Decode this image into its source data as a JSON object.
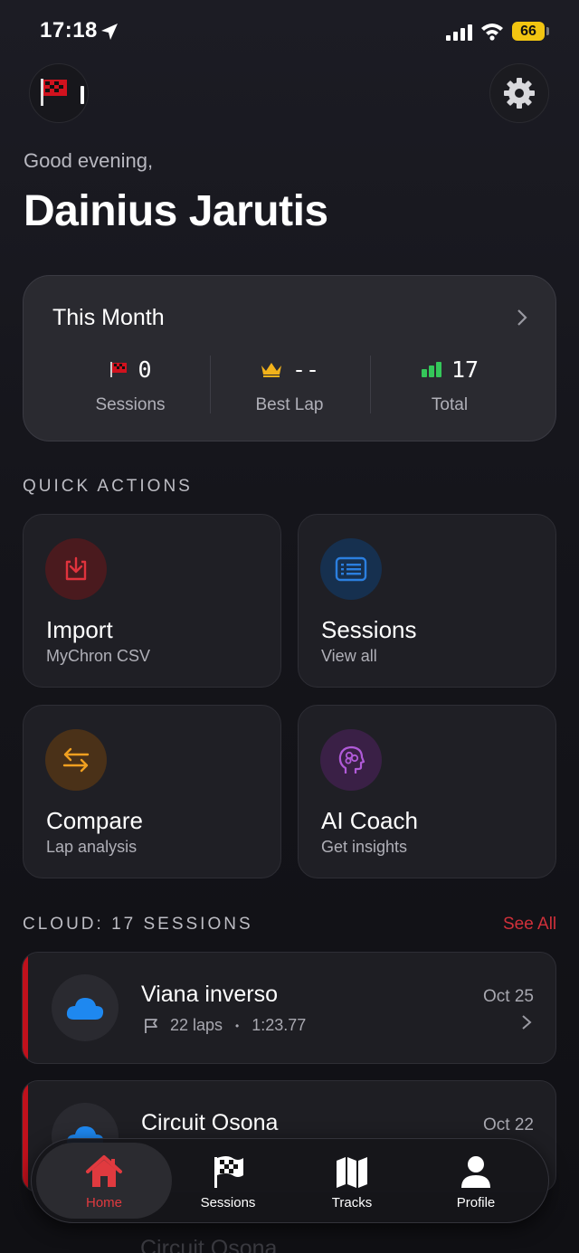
{
  "status_bar": {
    "time": "17:18",
    "battery": "66",
    "icons": [
      "location-arrow-icon",
      "cellular-signal-icon",
      "wifi-icon",
      "battery-icon"
    ]
  },
  "header": {
    "avatar_icon": "racing-flag-icon",
    "settings_icon": "gear-icon",
    "greeting": "Good evening,",
    "user_name": "Dainius Jarutis"
  },
  "this_month": {
    "title": "This Month",
    "stats": [
      {
        "icon": "red-flag-icon",
        "value": "0",
        "label": "Sessions"
      },
      {
        "icon": "crown-icon",
        "value": "--",
        "label": "Best Lap"
      },
      {
        "icon": "bar-chart-icon",
        "value": "17",
        "label": "Total"
      }
    ]
  },
  "quick_actions": {
    "title": "QUICK ACTIONS",
    "items": [
      {
        "title": "Import",
        "subtitle": "MyChron CSV",
        "icon": "import-icon",
        "color": "#d32f2f"
      },
      {
        "title": "Sessions",
        "subtitle": "View all",
        "icon": "list-icon",
        "color": "#2b7fe0"
      },
      {
        "title": "Compare",
        "subtitle": "Lap analysis",
        "icon": "swap-arrows-icon",
        "color": "#f0a020"
      },
      {
        "title": "AI Coach",
        "subtitle": "Get insights",
        "icon": "brain-head-icon",
        "color": "#b05ad8"
      }
    ]
  },
  "cloud": {
    "title": "CLOUD: 17 SESSIONS",
    "see_all": "See All",
    "sessions": [
      {
        "name": "Viana inverso",
        "laps": "22 laps",
        "separator": "•",
        "best": "1:23.77",
        "date": "Oct 25"
      },
      {
        "name": "Circuit Osona",
        "date": "Oct 22"
      },
      {
        "name": "Circuit Osona"
      }
    ]
  },
  "tab_bar": {
    "tabs": [
      {
        "label": "Home",
        "icon": "house-icon",
        "active": true
      },
      {
        "label": "Sessions",
        "icon": "checkered-flag-icon"
      },
      {
        "label": "Tracks",
        "icon": "map-icon"
      },
      {
        "label": "Profile",
        "icon": "person-icon"
      }
    ]
  },
  "colors": {
    "accent": "#d0303a",
    "background": "#15151b",
    "card": "#2a2a30"
  }
}
